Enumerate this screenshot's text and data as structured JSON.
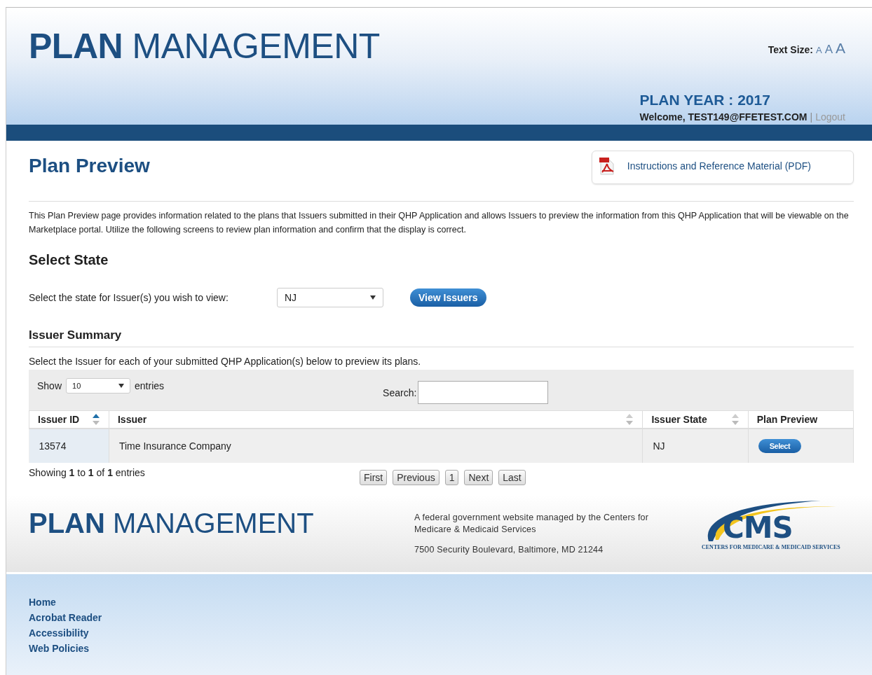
{
  "header": {
    "logo": "**PLAN** MANAGEMENT",
    "text_size": {
      "label": "Text Size:",
      "options": [
        "A",
        "A",
        "A"
      ]
    },
    "plan_year": "PLAN YEAR : 2017",
    "welcome": "Welcome, TEST149@FFETEST.COM",
    "separator": "|",
    "logout": "Logout"
  },
  "page": {
    "title": "Plan Preview",
    "pdf_link": "Instructions and Reference Material (PDF)",
    "intro": "This Plan Preview page provides information related to the plans that Issuers submitted in their QHP Application and allows Issuers to preview the information from this QHP Application that will be viewable on the Marketplace portal. Utilize the following screens to review plan information and confirm that the display is correct."
  },
  "select_state": {
    "heading": "Select State",
    "label": "Select the state for Issuer(s) you wish to view:",
    "value": "NJ",
    "button": "View Issuers"
  },
  "issuer_summary": {
    "heading": "Issuer Summary",
    "instructions": "Select the Issuer for each of your submitted QHP Application(s) below to preview its plans.",
    "show_label": "Show",
    "page_size": "10",
    "entries_label": "entries",
    "search_label": "Search:",
    "columns": [
      {
        "label": "Issuer ID",
        "sortable": true,
        "sorted": true
      },
      {
        "label": "Issuer",
        "sortable": true,
        "sorted": false
      },
      {
        "label": "Issuer State",
        "sortable": true,
        "sorted": false
      },
      {
        "label": "Plan Preview",
        "sortable": false
      }
    ],
    "rows": [
      {
        "issuer_id": "13574",
        "issuer": "Time Insurance Company",
        "state": "NJ",
        "action": "Select"
      }
    ],
    "info": "Showing **1** to **1** of **1** entries",
    "pagination": [
      "First",
      "Previous",
      "1",
      "Next",
      "Last"
    ]
  },
  "footer": {
    "logo": "**PLAN** MANAGEMENT",
    "description": "A federal government website managed by the Centers for Medicare & Medicaid Services",
    "address": "7500 Security Boulevard, Baltimore, MD 21244",
    "cms_logo": "CMS",
    "cms_subtitle": "CENTERS FOR MEDICARE & MEDICAID SERVICES",
    "links": [
      "Home",
      "Acrobat Reader",
      "Accessibility",
      "Web Policies"
    ]
  }
}
